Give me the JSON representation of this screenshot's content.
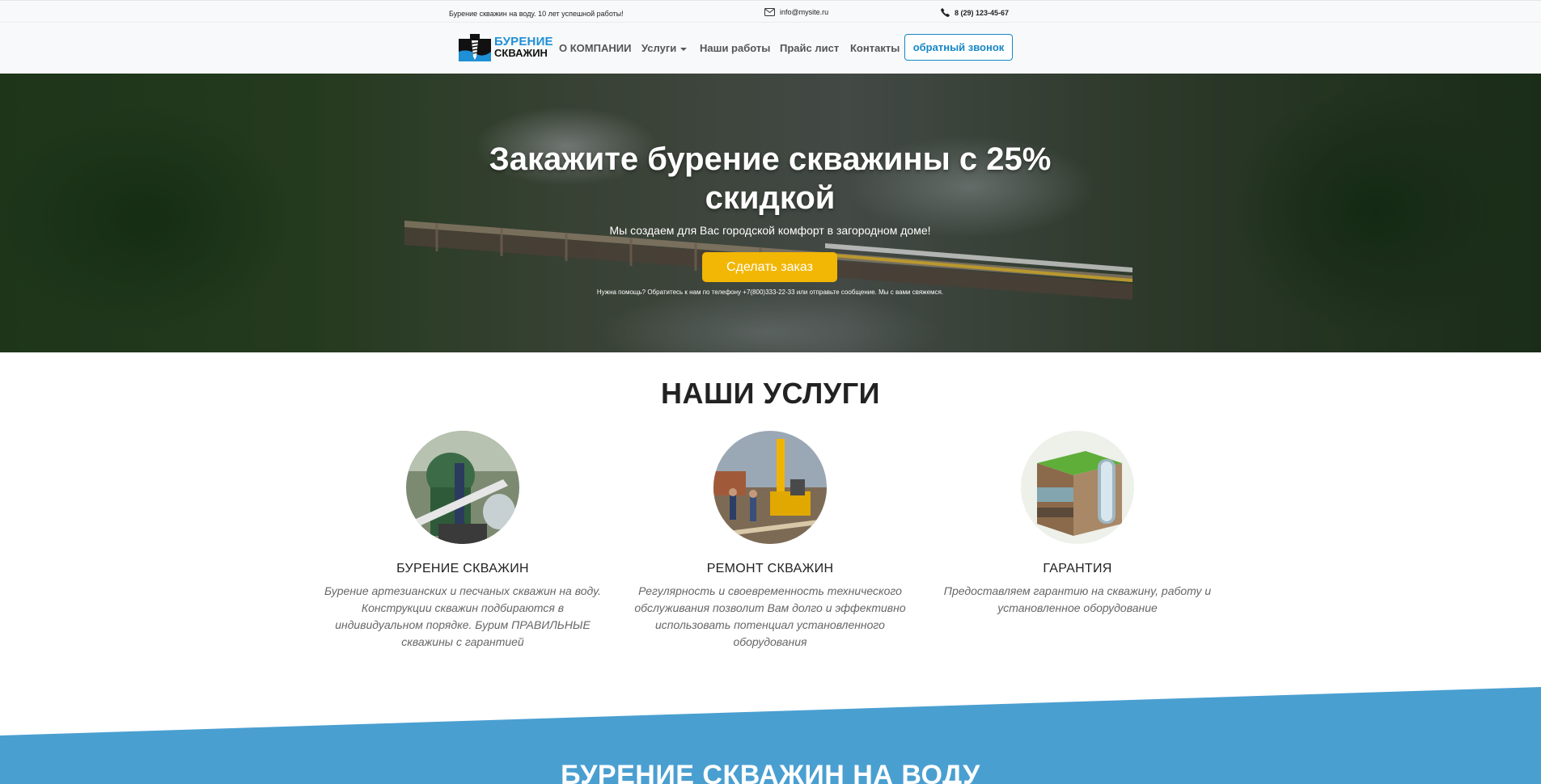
{
  "topbar": {
    "slogan": "Бурение скважин на воду. 10 лет успешной работы!",
    "email": "info@mysite.ru",
    "phone": "8 (29) 123-45-67",
    "email_icon": "envelope-icon",
    "phone_icon": "phone-icon"
  },
  "navbar": {
    "logo_line1": "БУРЕНИЕ",
    "logo_line2": "СКВАЖИН",
    "items": [
      {
        "label": "О КОМПАНИИ"
      },
      {
        "label": "Услуги",
        "dropdown": true
      },
      {
        "label": "Наши работы"
      },
      {
        "label": "Прайс лист"
      },
      {
        "label": "Контакты"
      }
    ],
    "callback_label": "обратный звонок"
  },
  "hero": {
    "title": "Закажите бурение скважины с 25% скидкой",
    "subtitle": "Мы создаем для Вас городской комфорт в загородном доме!",
    "button_label": "Сделать заказ",
    "help_text": "Нужна помощь? Обратитесь к нам по телефону +7(800)333-22-33 или отправьте сообщение. Мы с вами свяжемся."
  },
  "services": {
    "title": "НАШИ УСЛУГИ",
    "items": [
      {
        "name": "БУРЕНИЕ СКВАЖИН",
        "description": "Бурение артезианских и песчаных скважин на воду. Конструкции скважин подбираются в индивидуальном порядке. Бурим ПРАВИЛЬНЫЕ скважины с гарантией"
      },
      {
        "name": "РЕМОНТ СКВАЖИН",
        "description": "Регулярность и своевременность технического обслуживания позволит Вам долго и эффективно использовать потенциал установленного оборудования"
      },
      {
        "name": "ГАРАНТИЯ",
        "description": "Предоставляем гарантию на скважину, работу и установленное оборудование"
      }
    ]
  },
  "section2": {
    "title": "БУРЕНИЕ СКВАЖИН НА ВОДУ"
  },
  "colors": {
    "accent_blue": "#1687c6",
    "band_blue": "#4a9fd1",
    "button_yellow": "#f2b705"
  }
}
